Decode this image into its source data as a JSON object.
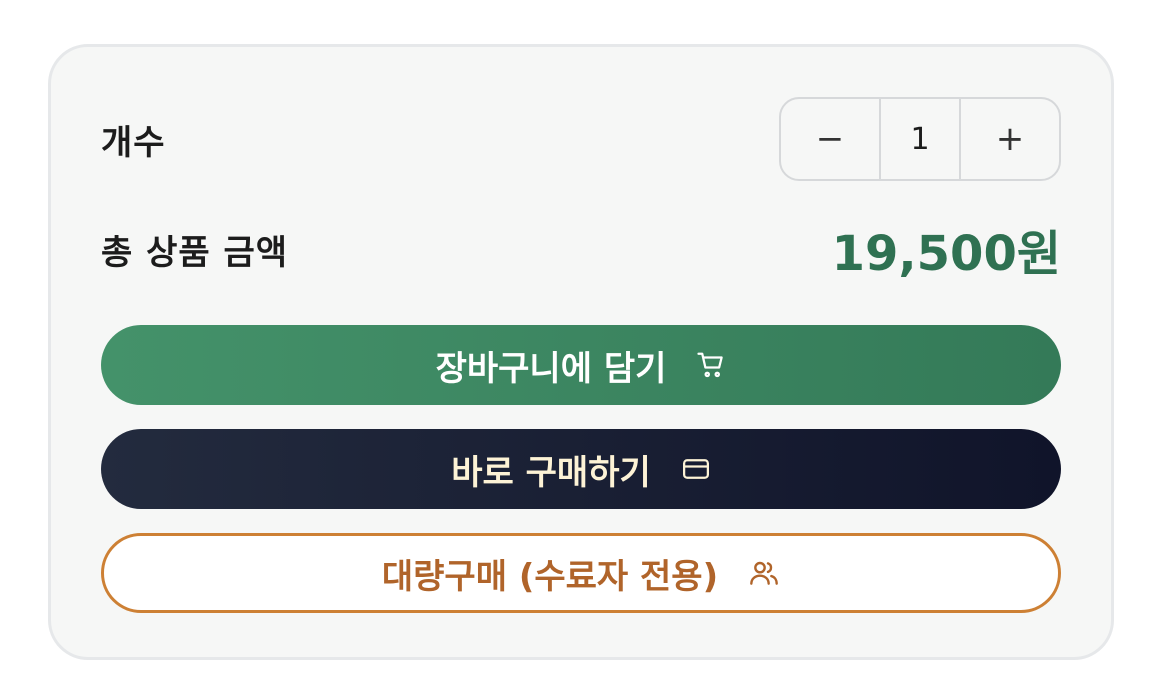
{
  "quantity": {
    "label": "개수",
    "minus": "−",
    "value": "1",
    "plus": "+"
  },
  "total": {
    "label": "총 상품 금액",
    "price": "19,500원"
  },
  "buttons": {
    "cart_label": "장바구니에 담기",
    "cart_icon": "shopping-cart-icon",
    "buy_label": "바로 구매하기",
    "buy_icon": "credit-card-icon",
    "bulk_label": "대량구매 (수료자 전용)",
    "bulk_icon": "users-icon"
  },
  "colors": {
    "accent_green": "#347a58",
    "price_green": "#2f7152",
    "dark_navy": "#10142a",
    "bulk_orange": "#cd8034"
  }
}
